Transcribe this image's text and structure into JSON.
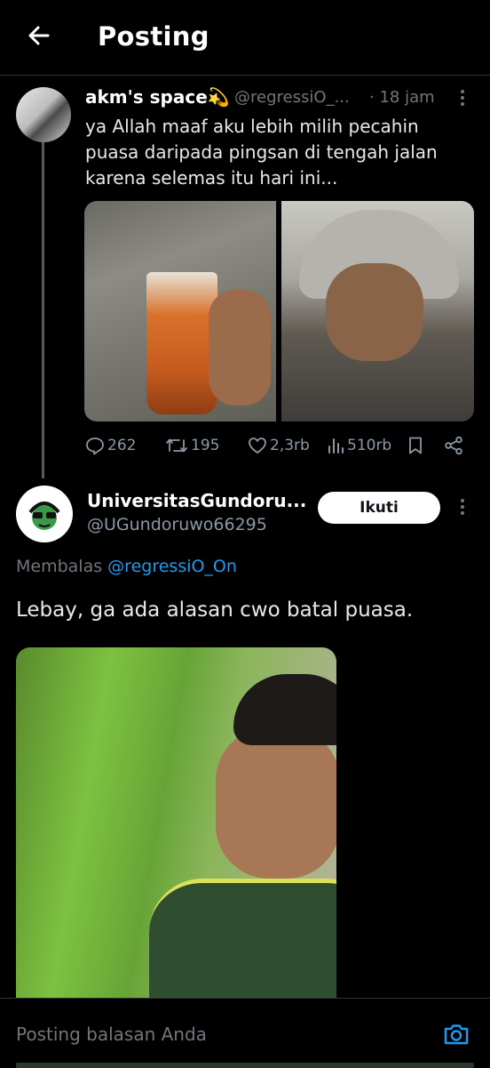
{
  "header": {
    "title": "Posting"
  },
  "original_post": {
    "display_name": "akm's space💫",
    "handle": "@regressiO_...",
    "time_separator": "·",
    "time": "18 jam",
    "text_lines": [
      "ya Allah maaf aku lebih milih pecahin",
      "puasa daripada pingsan di tengah jalan",
      "karena selemas itu hari ini..."
    ],
    "actions": {
      "replies": "262",
      "reposts": "195",
      "likes": "2,3rb",
      "views": "510rb"
    }
  },
  "reply_post": {
    "display_name": "UniversitasGundoru...",
    "handle": "@UGundoruwo66295",
    "follow_label": "Ikuti",
    "replying_prefix": "Membalas",
    "replying_to": "@regressiO_On",
    "text": "Lebay, ga ada alasan cwo batal puasa."
  },
  "compose": {
    "placeholder": "Posting balasan Anda"
  },
  "colors": {
    "background": "#000000",
    "secondary_text": "#71767b",
    "link": "#1d9bf0",
    "follow_button_bg": "#ffffff"
  },
  "icons": {
    "back": "arrow-left-icon",
    "more": "more-vertical-icon",
    "reply": "reply-icon",
    "repost": "repost-icon",
    "like": "heart-icon",
    "views": "views-icon",
    "bookmark": "bookmark-icon",
    "share": "share-icon",
    "camera": "camera-icon"
  }
}
